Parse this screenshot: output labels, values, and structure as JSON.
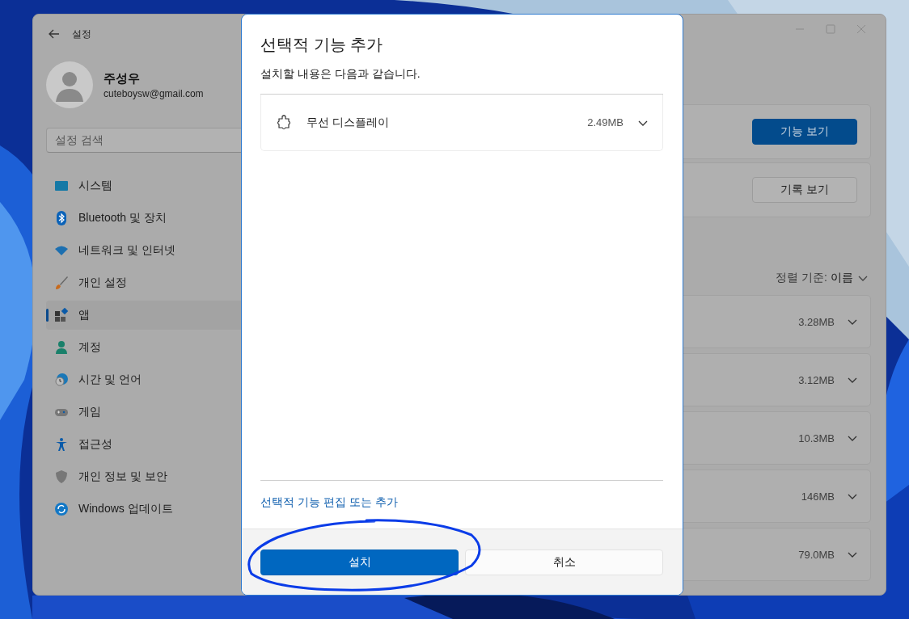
{
  "window": {
    "title": "설정"
  },
  "profile": {
    "name": "주성우",
    "email": "cuteboysw@gmail.com"
  },
  "search": {
    "placeholder": "설정 검색"
  },
  "nav": [
    {
      "label": "시스템",
      "kind": "system",
      "selected": false
    },
    {
      "label": "Bluetooth 및 장치",
      "kind": "bluetooth",
      "selected": false
    },
    {
      "label": "네트워크 및 인터넷",
      "kind": "network",
      "selected": false
    },
    {
      "label": "개인 설정",
      "kind": "brush",
      "selected": false
    },
    {
      "label": "앱",
      "kind": "apps",
      "selected": true
    },
    {
      "label": "계정",
      "kind": "account",
      "selected": false
    },
    {
      "label": "시간 및 언어",
      "kind": "time",
      "selected": false
    },
    {
      "label": "게임",
      "kind": "gaming",
      "selected": false
    },
    {
      "label": "접근성",
      "kind": "accessibility",
      "selected": false
    },
    {
      "label": "개인 정보 및 보안",
      "kind": "privacy",
      "selected": false
    },
    {
      "label": "Windows 업데이트",
      "kind": "update",
      "selected": false
    }
  ],
  "content": {
    "cards": [
      {
        "button": "기능 보기",
        "primary": true
      },
      {
        "button": "기록 보기",
        "primary": false
      }
    ],
    "sort": {
      "label": "정렬 기준:",
      "value": "이름"
    },
    "features": [
      {
        "size": "3.28MB",
        "expanded": false
      },
      {
        "size": "3.12MB",
        "expanded": false
      },
      {
        "size": "10.3MB",
        "expanded": false
      },
      {
        "size": "146MB",
        "expanded": false
      },
      {
        "size": "79.0MB",
        "expanded": false
      }
    ]
  },
  "dialog": {
    "title": "선택적 기능 추가",
    "subtitle": "설치할 내용은 다음과 같습니다.",
    "items": [
      {
        "name": "무선 디스플레이",
        "size": "2.49MB",
        "expanded": false
      }
    ],
    "link": "선택적 기능 편집 또는 추가",
    "buttons": [
      {
        "label": "설치",
        "primary": true
      },
      {
        "label": "취소",
        "primary": false
      }
    ]
  }
}
